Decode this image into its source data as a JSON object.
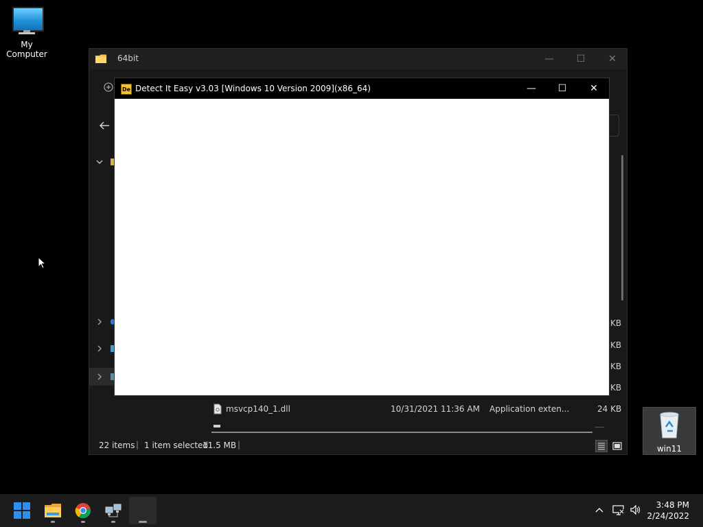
{
  "desktop": {
    "my_computer_label": "My Computer",
    "recycle_bin_label": "win11"
  },
  "explorer": {
    "title": "64bit",
    "file_row": {
      "name": "msvcp140_1.dll",
      "date": "10/31/2021 11:36 AM",
      "type": "Application exten...",
      "size": "24 KB"
    },
    "partial_sizes": [
      "KB",
      "KB",
      "KB",
      "KB"
    ],
    "status": {
      "items": "22 items",
      "selected": "1 item selected",
      "size": "11.5 MB"
    }
  },
  "die_window": {
    "title": "Detect It Easy v3.03 [Windows 10 Version 2009](x86_64)",
    "logo_text": "De"
  },
  "taskbar": {
    "time": "3:48 PM",
    "date": "2/24/2022"
  },
  "colors": {
    "explorer_bg": "#191919",
    "die_content": "#ffffff",
    "taskbar_bg": "#1c1c1c",
    "start_blue": "#2f8ff0"
  }
}
